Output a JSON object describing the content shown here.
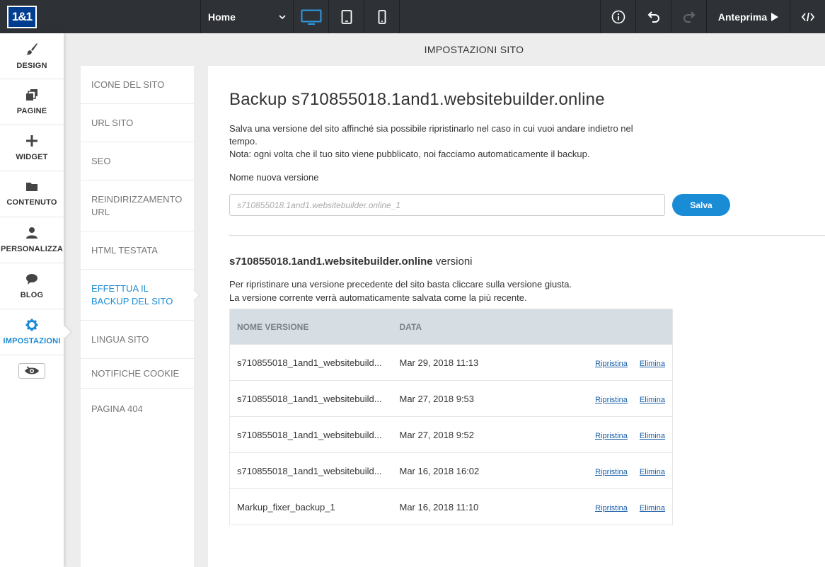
{
  "topbar": {
    "logo_text": "1&1",
    "page_select": "Home",
    "preview_label": "Anteprima"
  },
  "colors": {
    "accent": "#1a8bd5",
    "topbar": "#2e3236",
    "logo": "#003d8f"
  },
  "nav": {
    "items": [
      {
        "label": "DESIGN",
        "icon": "brush-icon"
      },
      {
        "label": "PAGINE",
        "icon": "pages-icon"
      },
      {
        "label": "WIDGET",
        "icon": "plus-icon"
      },
      {
        "label": "CONTENUTO",
        "icon": "folder-icon"
      },
      {
        "label": "PERSONALIZZA",
        "icon": "user-icon"
      },
      {
        "label": "BLOG",
        "icon": "chat-bubble-icon"
      },
      {
        "label": "IMPOSTAZIONI",
        "icon": "gear-icon"
      }
    ]
  },
  "settings": {
    "title": "IMPOSTAZIONI SITO",
    "menu": [
      "ICONE DEL SITO",
      "URL SITO",
      "SEO",
      "REINDIRIZZAMENTO URL",
      "HTML TESTATA",
      "EFFETTUA IL BACKUP DEL SITO",
      "LINGUA SITO",
      "NOTIFICHE COOKIE",
      "PAGINA 404"
    ]
  },
  "main": {
    "heading": "Backup s710855018.1and1.websitebuilder.online",
    "desc_line1": "Salva una versione del sito affinché sia possibile ripristinarlo nel caso in cui vuoi andare indietro nel tempo.",
    "desc_line2": "Nota: ogni volta che il tuo sito viene pubblicato, noi facciamo automaticamente il backup.",
    "field_label": "Nome nuova versione",
    "input_placeholder": "s710855018.1and1.websitebuilder.online_1",
    "save_label": "Salva",
    "versions_site": "s710855018.1and1.websitebuilder.online",
    "versions_suffix": " versioni",
    "versions_desc_line1": "Per ripristinare una versione precedente del sito basta cliccare sulla versione giusta.",
    "versions_desc_line2": "La versione corrente verrà automaticamente salvata come la più recente."
  },
  "table": {
    "headers": [
      "NOME VERSIONE",
      "DATA"
    ],
    "restore_label": "Ripristina",
    "delete_label": "Elimina",
    "rows": [
      {
        "name": "s710855018_1and1_websitebuild...",
        "date": "Mar 29, 2018 11:13"
      },
      {
        "name": "s710855018_1and1_websitebuild...",
        "date": "Mar 27, 2018 9:53"
      },
      {
        "name": "s710855018_1and1_websitebuild...",
        "date": "Mar 27, 2018 9:52"
      },
      {
        "name": "s710855018_1and1_websitebuild...",
        "date": "Mar 16, 2018 16:02"
      },
      {
        "name": "Markup_fixer_backup_1",
        "date": "Mar 16, 2018 11:10"
      }
    ]
  }
}
